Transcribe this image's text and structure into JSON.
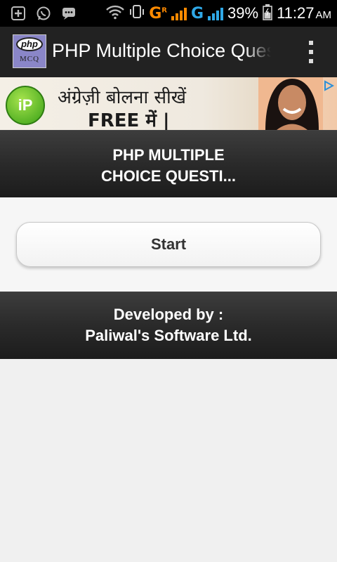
{
  "status_bar": {
    "icons": [
      "add-notification-icon",
      "whatsapp-icon",
      "chat-icon",
      "wifi-icon",
      "phone-icon"
    ],
    "network1": "G",
    "network1_roaming": "R",
    "network2": "G",
    "battery": "39%",
    "time": "11:27",
    "ampm": "AM"
  },
  "action_bar": {
    "logo_top": "php",
    "logo_bottom": "MCQ",
    "title": "PHP Multiple Choice Questions"
  },
  "ad": {
    "logo_text": "iP",
    "line1": "अंग्रेज़ी बोलना सीखें",
    "line2": "FREE में |"
  },
  "header": {
    "line1": "PHP MULTIPLE",
    "line2": "CHOICE QUESTI..."
  },
  "start_label": "Start",
  "footer": {
    "line1": "Developed by :",
    "line2": "Paliwal's Software Ltd."
  }
}
